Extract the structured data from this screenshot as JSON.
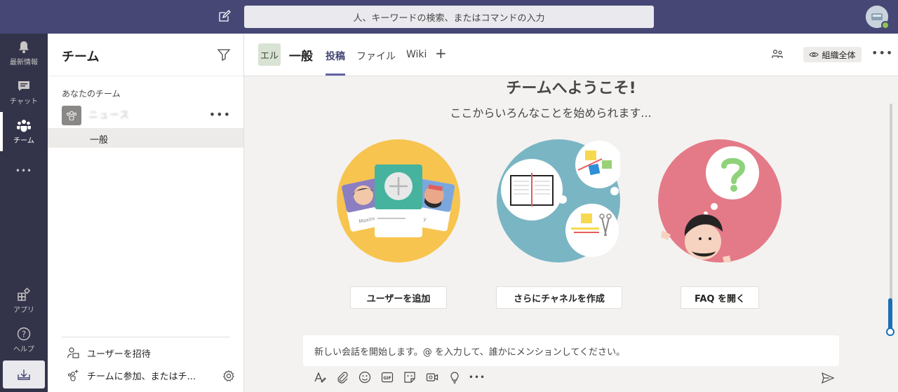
{
  "topbar": {
    "search_placeholder": "人、キーワードの検索、またはコマンドの入力"
  },
  "rail": {
    "items": [
      {
        "label": "最新情報",
        "icon": "bell-icon"
      },
      {
        "label": "チャット",
        "icon": "chat-icon"
      },
      {
        "label": "チーム",
        "icon": "teams-icon"
      },
      {
        "label": "•••",
        "icon": "more-icon"
      },
      {
        "label": "アプリ",
        "icon": "apps-icon"
      },
      {
        "label": "ヘルプ",
        "icon": "help-icon"
      }
    ]
  },
  "teams_panel": {
    "title": "チーム",
    "section_label": "あなたのチーム",
    "team_name": "ニュース",
    "channel_name": "一般",
    "invite_label": "ユーザーを招待",
    "join_label": "チームに参加、またはチ..."
  },
  "channel": {
    "badge": "エル",
    "title": "一般",
    "tabs": [
      "投稿",
      "ファイル",
      "Wiki"
    ],
    "org_label": "組織全体"
  },
  "welcome": {
    "title": "チームへようこそ!",
    "subtitle": "ここからいろんなことを始められます...",
    "card_names": [
      "Maxine",
      "y"
    ],
    "actions": [
      "ユーザーを追加",
      "さらにチャネルを作成",
      "FAQ を開く"
    ]
  },
  "compose": {
    "placeholder": "新しい会話を開始します。@ を入力して、誰かにメンションしてください。"
  },
  "colors": {
    "topbar": "#464775",
    "rail": "#33344a",
    "accent": "#6264a7"
  }
}
